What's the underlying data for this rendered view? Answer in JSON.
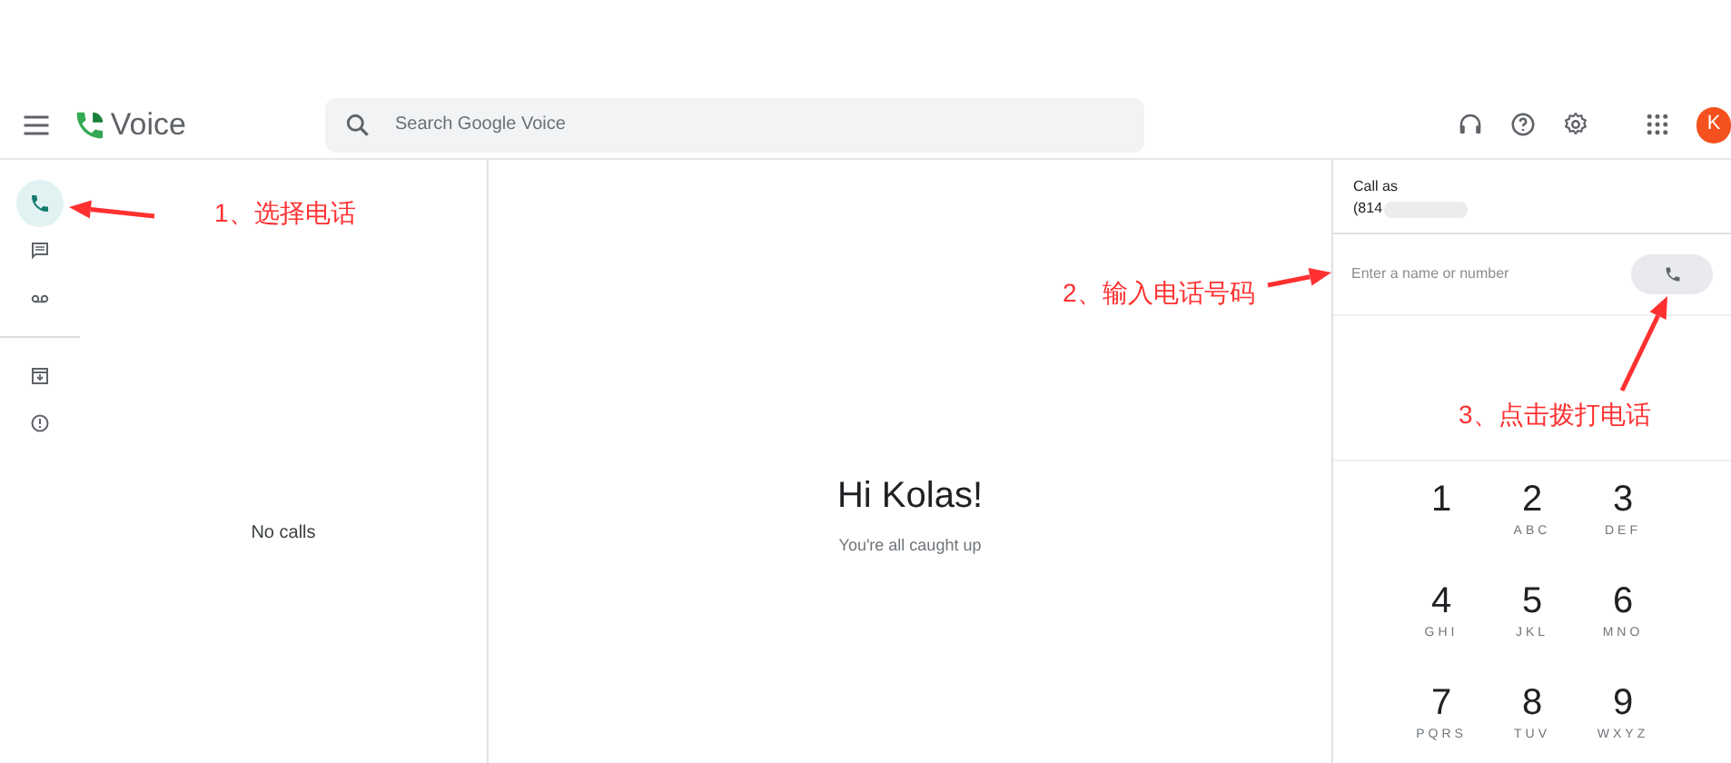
{
  "header": {
    "app_name": "Voice",
    "search": {
      "placeholder": "Search Google Voice"
    },
    "avatar": "K"
  },
  "nav": [
    {
      "kind": "calls",
      "selected": true
    },
    {
      "kind": "messages",
      "selected": false
    },
    {
      "kind": "voicemail",
      "selected": false
    },
    {
      "kind": "archive",
      "selected": false
    },
    {
      "kind": "spam",
      "selected": false
    }
  ],
  "list": {
    "empty_text": "No calls"
  },
  "main": {
    "greeting": "Hi Kolas!",
    "subtitle": "You're all caught up"
  },
  "call_panel": {
    "label": "Call as",
    "number": "(814",
    "input": {
      "placeholder": "Enter a name or number"
    },
    "keypad": [
      {
        "digit": "1"
      },
      {
        "digit": "2",
        "letters": "ABC"
      },
      {
        "digit": "3",
        "letters": "DEF"
      },
      {
        "digit": "4",
        "letters": "GHI"
      },
      {
        "digit": "5",
        "letters": "JKL"
      },
      {
        "digit": "6",
        "letters": "MNO"
      },
      {
        "digit": "7",
        "letters": "PQRS"
      },
      {
        "digit": "8",
        "letters": "TUV"
      },
      {
        "digit": "9",
        "letters": "WXYZ"
      }
    ]
  },
  "annotations": [
    {
      "text": "1、选择电话"
    },
    {
      "text": "2、输入电话号码"
    },
    {
      "text": "3、点击拨打电话"
    }
  ]
}
